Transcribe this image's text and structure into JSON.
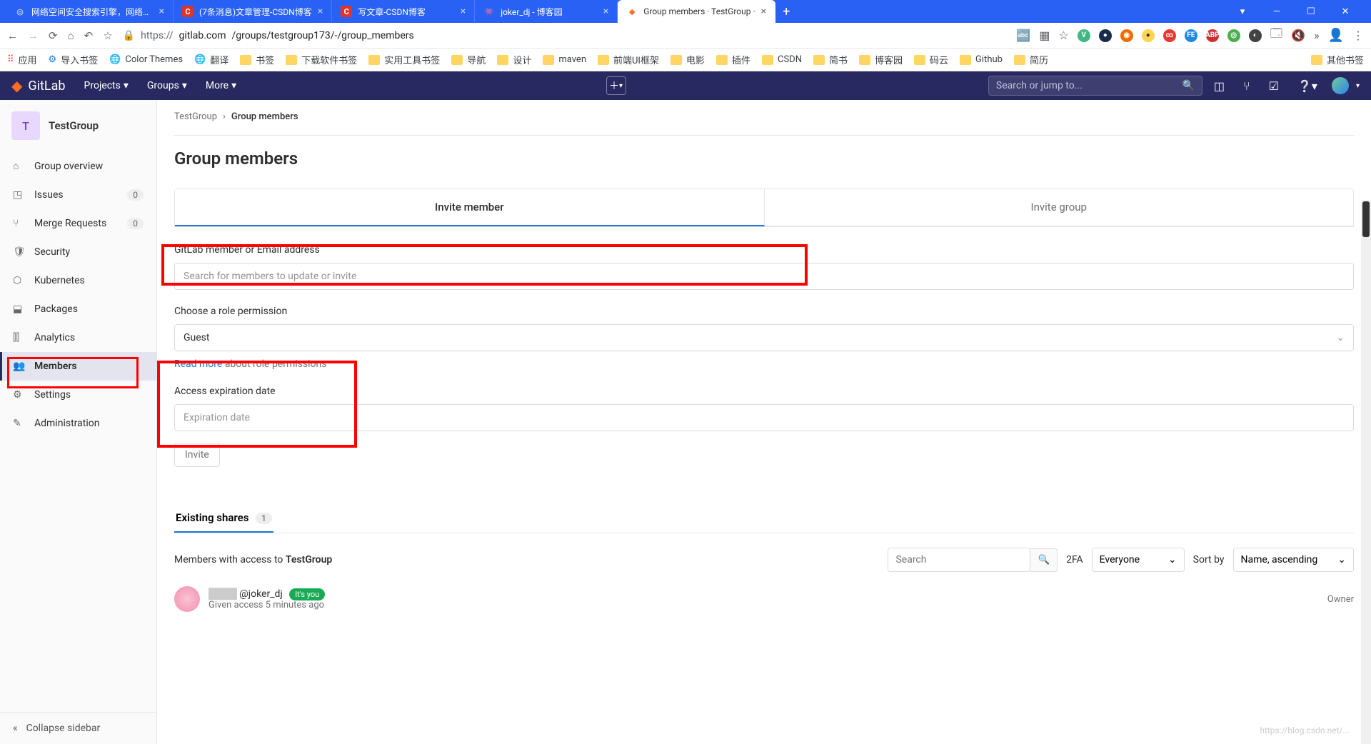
{
  "browser": {
    "tabs": [
      {
        "title": "网络空间安全搜索引擎，网络空..."
      },
      {
        "title": "(7条消息)文章管理-CSDN博客"
      },
      {
        "title": "写文章-CSDN博客"
      },
      {
        "title": "joker_dj - 博客园"
      },
      {
        "title": "Group members · TestGroup · ",
        "active": true
      }
    ],
    "url_scheme": "https://",
    "url_domain": "gitlab.com",
    "url_path": "/groups/testgroup173/-/group_members",
    "bookmarks": {
      "apps": "应用",
      "import": "导入书签",
      "themes": "Color Themes",
      "translate": "翻译",
      "folders": [
        "书签",
        "下载软件书签",
        "实用工具书签",
        "导航",
        "设计",
        "maven",
        "前端UI框架",
        "电影",
        "插件",
        "CSDN",
        "简书",
        "博客园",
        "码云",
        "Github",
        "简历"
      ],
      "other": "其他书签"
    }
  },
  "gitlab_header": {
    "brand": "GitLab",
    "nav": {
      "projects": "Projects",
      "groups": "Groups",
      "more": "More"
    },
    "search_placeholder": "Search or jump to..."
  },
  "sidebar": {
    "group_initial": "T",
    "group_name": "TestGroup",
    "items": [
      {
        "icon": "⌂",
        "label": "Group overview"
      },
      {
        "icon": "◳",
        "label": "Issues",
        "badge": "0"
      },
      {
        "icon": "⑂",
        "label": "Merge Requests",
        "badge": "0"
      },
      {
        "icon": "🛡",
        "label": "Security"
      },
      {
        "icon": "⬡",
        "label": "Kubernetes"
      },
      {
        "icon": "⬓",
        "label": "Packages"
      },
      {
        "icon": "⫿⫿",
        "label": "Analytics"
      },
      {
        "icon": "👥",
        "label": "Members",
        "active": true
      },
      {
        "icon": "⚙",
        "label": "Settings"
      },
      {
        "icon": "✎",
        "label": "Administration"
      }
    ],
    "collapse": "Collapse sidebar"
  },
  "breadcrumb": {
    "parent": "TestGroup",
    "current": "Group members"
  },
  "page": {
    "title": "Group members",
    "tabs": {
      "invite_member": "Invite member",
      "invite_group": "Invite group"
    },
    "form": {
      "member_label": "GitLab member or Email address",
      "member_placeholder": "Search for members to update or invite",
      "role_label": "Choose a role permission",
      "role_value": "Guest",
      "read_more": "Read more",
      "read_more_suffix": " about role permissions",
      "expiry_label": "Access expiration date",
      "expiry_placeholder": "Expiration date",
      "invite_btn": "Invite"
    },
    "shares": {
      "label": "Existing shares",
      "count": "1"
    },
    "filters": {
      "members_prefix": "Members with access to ",
      "members_group": "TestGroup",
      "search_placeholder": "Search",
      "twofa": "2FA",
      "twofa_value": "Everyone",
      "sort_by": "Sort by",
      "sort_value": "Name, ascending"
    },
    "member": {
      "handle": "@joker_dj",
      "its_you": "It's you",
      "given": "Given access 5 minutes ago",
      "role": "Owner"
    }
  }
}
